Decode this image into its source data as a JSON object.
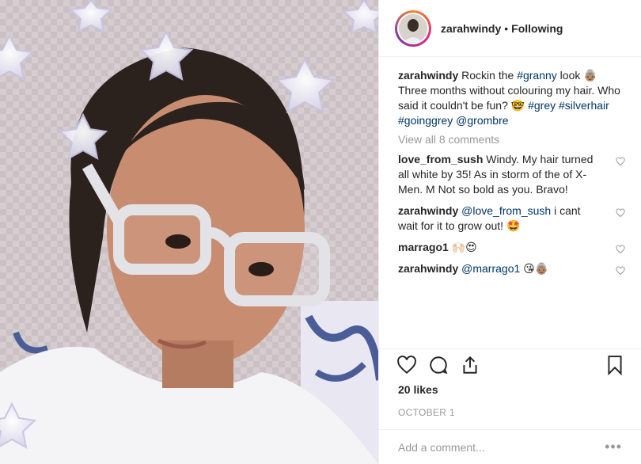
{
  "header": {
    "username": "zarahwindy",
    "separator": "•",
    "follow_status": "Following"
  },
  "caption": {
    "username": "zarahwindy",
    "text_1": "Rockin the",
    "tag_granny": "#granny",
    "text_2": "look 👵🏽 Three months without colouring my hair. Who said it couldn't be fun? 🤓",
    "tag_grey": "#grey",
    "tag_silverhair": "#silverhair",
    "tag_goinggrey": "#goinggrey",
    "mention_grombre": "@grombre"
  },
  "view_all": "View all 8 comments",
  "comments": [
    {
      "username": "love_from_sush",
      "text": "Windy. My hair turned all white by 35! As in storm of the of X-Men. M Not so bold as you. Bravo!"
    },
    {
      "username": "zarahwindy",
      "mention": "@love_from_sush",
      "text": "i cant wait for it to grow out! 🤩"
    },
    {
      "username": "marrago1",
      "text": "🙌🏻😍"
    },
    {
      "username": "zarahwindy",
      "mention": "@marrago1",
      "text": "😘👵🏽"
    }
  ],
  "likes": "20 likes",
  "date": "OCTOBER 1",
  "add_comment": {
    "placeholder": "Add a comment..."
  },
  "more": "•••",
  "colors": {
    "link": "#003569",
    "muted": "#999999",
    "text": "#262626"
  },
  "icons": [
    "heart-icon",
    "comment-icon",
    "share-icon",
    "bookmark-icon"
  ]
}
